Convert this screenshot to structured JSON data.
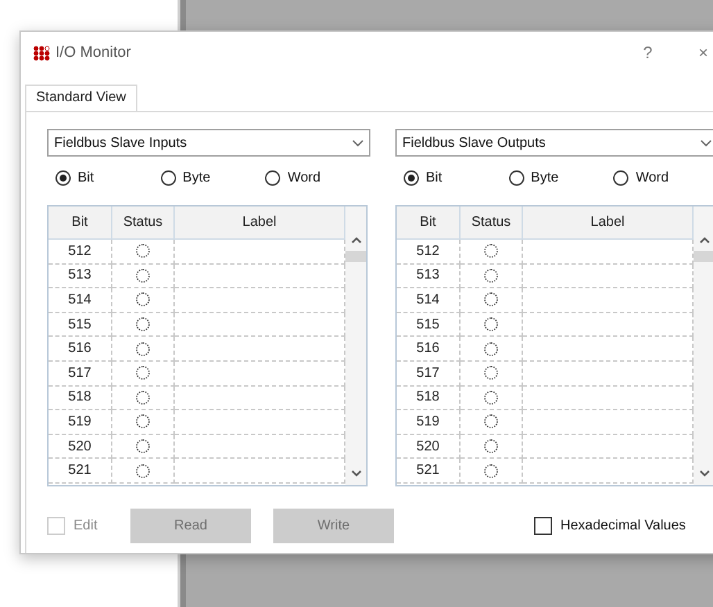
{
  "window": {
    "title": "I/O Monitor",
    "help": "?",
    "close": "×"
  },
  "tabs": [
    {
      "label": "Standard View",
      "selected": true
    }
  ],
  "panels": [
    {
      "source": "Fieldbus Slave Inputs",
      "modes": [
        {
          "label": "Bit",
          "selected": true
        },
        {
          "label": "Byte",
          "selected": false
        },
        {
          "label": "Word",
          "selected": false
        }
      ],
      "columns": [
        "Bit",
        "Status",
        "Label"
      ],
      "rows": [
        {
          "bit": "512",
          "on": false
        },
        {
          "bit": "513",
          "on": false
        },
        {
          "bit": "514",
          "on": false
        },
        {
          "bit": "515",
          "on": false
        },
        {
          "bit": "516",
          "on": false
        },
        {
          "bit": "517",
          "on": false
        },
        {
          "bit": "518",
          "on": false
        },
        {
          "bit": "519",
          "on": false
        },
        {
          "bit": "520",
          "on": false
        },
        {
          "bit": "521",
          "on": false
        }
      ]
    },
    {
      "source": "Fieldbus Slave Outputs",
      "modes": [
        {
          "label": "Bit",
          "selected": true
        },
        {
          "label": "Byte",
          "selected": false
        },
        {
          "label": "Word",
          "selected": false
        }
      ],
      "columns": [
        "Bit",
        "Status",
        "Label"
      ],
      "rows": [
        {
          "bit": "512",
          "on": false
        },
        {
          "bit": "513",
          "on": false
        },
        {
          "bit": "514",
          "on": false
        },
        {
          "bit": "515",
          "on": false
        },
        {
          "bit": "516",
          "on": false
        },
        {
          "bit": "517",
          "on": false
        },
        {
          "bit": "518",
          "on": false
        },
        {
          "bit": "519",
          "on": false
        },
        {
          "bit": "520",
          "on": false
        },
        {
          "bit": "521",
          "on": false
        }
      ]
    }
  ],
  "edit": {
    "label": "Edit",
    "checked": false,
    "disabled": true
  },
  "buttons": [
    {
      "label": "Read",
      "disabled": true
    },
    {
      "label": "Write",
      "disabled": true
    }
  ],
  "hexadecimal": {
    "label": "Hexadecimal Values",
    "checked": false
  }
}
